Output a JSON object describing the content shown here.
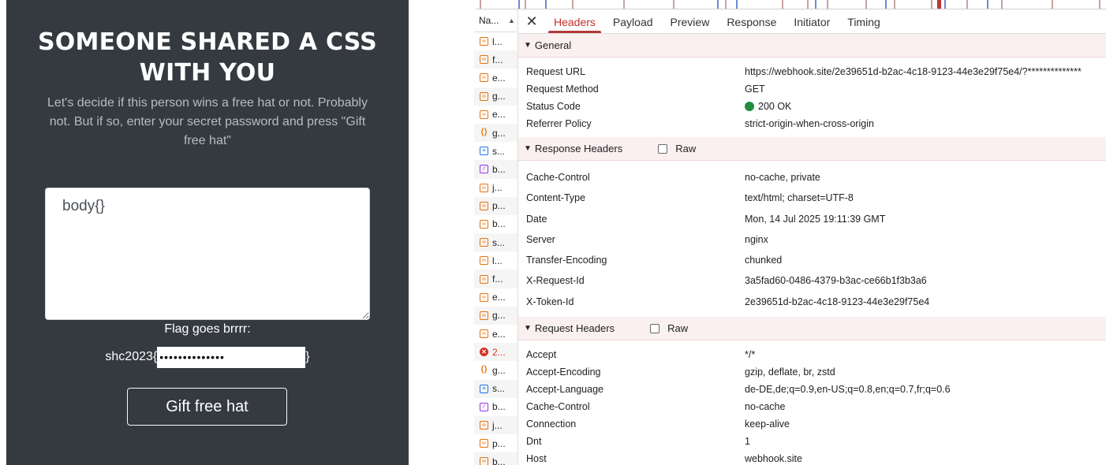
{
  "page": {
    "title": "SOMEONE SHARED A CSS WITH YOU",
    "description": "Let's decide if this person wins a free hat or not. Probably not. But if so, enter your secret password and press \"Gift free hat\"",
    "css_input_value": "body{}",
    "flag_label": "Flag goes brrrr:",
    "flag_prefix": "shc2023{",
    "flag_suffix": "}",
    "password_value": "••••••••••••••",
    "button_label": "Gift free hat"
  },
  "devtools": {
    "name_header": "Na...",
    "requests": [
      {
        "icon": "document-icon",
        "label": "l..."
      },
      {
        "icon": "document-icon",
        "label": "f..."
      },
      {
        "icon": "document-icon",
        "label": "e..."
      },
      {
        "icon": "document-icon",
        "label": "g..."
      },
      {
        "icon": "document-icon",
        "label": "e..."
      },
      {
        "icon": "script-icon",
        "label": "g..."
      },
      {
        "icon": "text-icon",
        "label": "s..."
      },
      {
        "icon": "image-icon",
        "label": "b..."
      },
      {
        "icon": "document-icon",
        "label": "j..."
      },
      {
        "icon": "document-icon",
        "label": "p..."
      },
      {
        "icon": "document-icon",
        "label": "b..."
      },
      {
        "icon": "document-icon",
        "label": "s..."
      },
      {
        "icon": "document-icon",
        "label": "l..."
      },
      {
        "icon": "document-icon",
        "label": "f..."
      },
      {
        "icon": "document-icon",
        "label": "e..."
      },
      {
        "icon": "document-icon",
        "label": "g..."
      },
      {
        "icon": "document-icon",
        "label": "e..."
      },
      {
        "icon": "error-icon",
        "label": "2..."
      },
      {
        "icon": "script-icon",
        "label": "g..."
      },
      {
        "icon": "text-icon",
        "label": "s..."
      },
      {
        "icon": "image-icon",
        "label": "b..."
      },
      {
        "icon": "document-icon",
        "label": "j..."
      },
      {
        "icon": "document-icon",
        "label": "p..."
      },
      {
        "icon": "document-icon",
        "label": "b..."
      }
    ],
    "tabs": [
      "Headers",
      "Payload",
      "Preview",
      "Response",
      "Initiator",
      "Timing"
    ],
    "active_tab": "Headers",
    "general": {
      "title": "General",
      "rows": [
        {
          "k": "Request URL",
          "v": "https://webhook.site/2e39651d-b2ac-4c18-9123-44e3e29f75e4/?**************"
        },
        {
          "k": "Request Method",
          "v": "GET"
        },
        {
          "k": "Status Code",
          "v": "200 OK"
        },
        {
          "k": "Referrer Policy",
          "v": "strict-origin-when-cross-origin"
        }
      ]
    },
    "response_headers": {
      "title": "Response Headers",
      "raw_label": "Raw",
      "rows": [
        {
          "k": "Cache-Control",
          "v": "no-cache, private"
        },
        {
          "k": "Content-Type",
          "v": "text/html; charset=UTF-8"
        },
        {
          "k": "Date",
          "v": "Mon, 14 Jul 2025 19:11:39 GMT"
        },
        {
          "k": "Server",
          "v": "nginx"
        },
        {
          "k": "Transfer-Encoding",
          "v": "chunked"
        },
        {
          "k": "X-Request-Id",
          "v": "3a5fad60-0486-4379-b3ac-ce66b1f3b3a6"
        },
        {
          "k": "X-Token-Id",
          "v": "2e39651d-b2ac-4c18-9123-44e3e29f75e4"
        }
      ]
    },
    "request_headers": {
      "title": "Request Headers",
      "raw_label": "Raw",
      "rows": [
        {
          "k": "Accept",
          "v": "*/*"
        },
        {
          "k": "Accept-Encoding",
          "v": "gzip, deflate, br, zstd"
        },
        {
          "k": "Accept-Language",
          "v": "de-DE,de;q=0.9,en-US;q=0.8,en;q=0.7,fr;q=0.6"
        },
        {
          "k": "Cache-Control",
          "v": "no-cache"
        },
        {
          "k": "Connection",
          "v": "keep-alive"
        },
        {
          "k": "Dnt",
          "v": "1"
        },
        {
          "k": "Host",
          "v": "webhook.site"
        }
      ]
    }
  }
}
